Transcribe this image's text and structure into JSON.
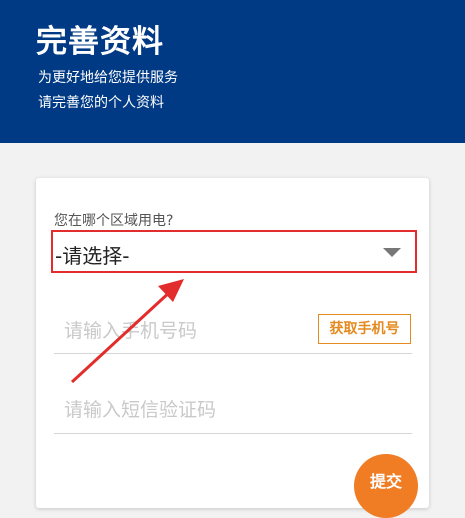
{
  "header": {
    "title": "完善资料",
    "subtitle_line1": "为更好地给您提供服务",
    "subtitle_line2": "请完善您的个人资料",
    "bg_color": "#003a84"
  },
  "form": {
    "region_label": "您在哪个区域用电?",
    "region_select_value": "-请选择-",
    "phone_placeholder": "请输入手机号码",
    "get_code_label": "获取手机号",
    "sms_placeholder": "请输入短信验证码",
    "submit_label": "提交"
  },
  "colors": {
    "highlight_border": "#e32c2c",
    "accent_orange": "#f07c24"
  }
}
